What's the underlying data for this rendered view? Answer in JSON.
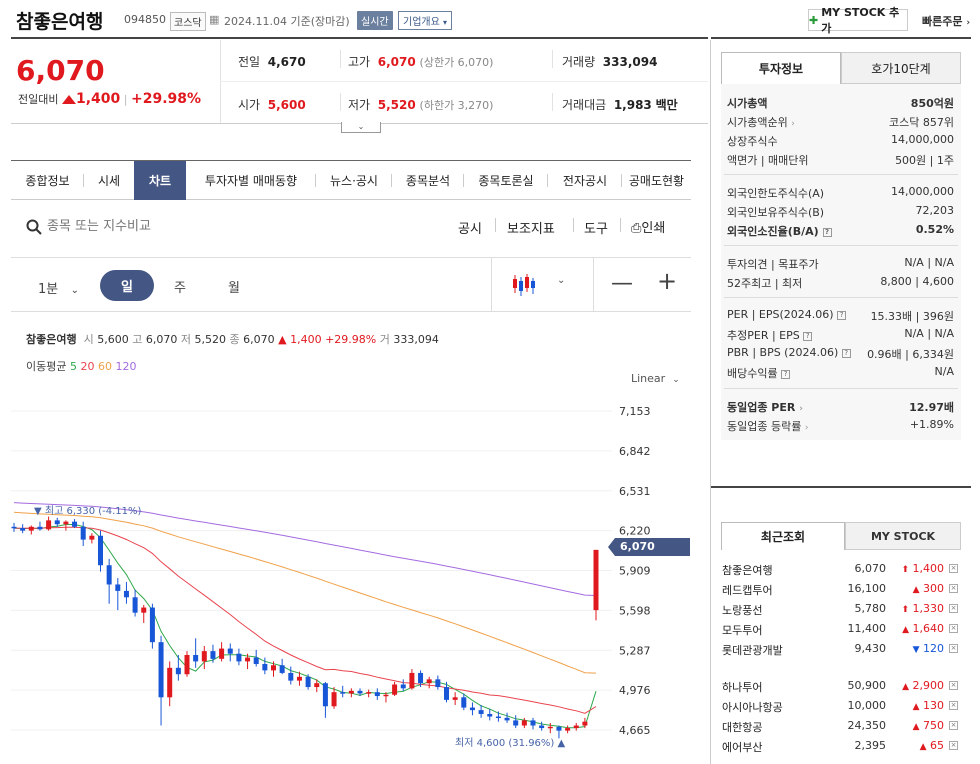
{
  "header": {
    "name": "참좋은여행",
    "code": "094850",
    "market": "코스닥",
    "date": "2024.11.04",
    "basis": "기준(장마감)",
    "realtime": "실시간",
    "company_info": "기업개요",
    "mystock_btn": "MY STOCK 추가",
    "quick_order": "빠른주문"
  },
  "quote": {
    "price": "6,070",
    "change_label": "전일대비",
    "change": "1,400",
    "change_pct": "+29.98%",
    "prev_label": "전일",
    "prev": "4,670",
    "high_label": "고가",
    "high": "6,070",
    "upper_limit": "(상한가 6,070)",
    "volume_label": "거래량",
    "volume": "333,094",
    "open_label": "시가",
    "open": "5,600",
    "low_label": "저가",
    "low": "5,520",
    "lower_limit": "(하한가 3,270)",
    "amount_label": "거래대금",
    "amount": "1,983",
    "amount_unit": "백만"
  },
  "tabs": [
    "종합정보",
    "시세",
    "차트",
    "투자자별 매매동향",
    "뉴스·공시",
    "종목분석",
    "종목토론실",
    "전자공시",
    "공매도현황"
  ],
  "search": {
    "placeholder": "종목 또는 지수비교",
    "tools": [
      "공시",
      "보조지표",
      "도구",
      "인쇄"
    ]
  },
  "periods": {
    "minute": "1분",
    "day": "일",
    "week": "주",
    "month": "월"
  },
  "chart_info": {
    "name": "참좋은여행",
    "open_label": "시",
    "open": "5,600",
    "high_label": "고",
    "high": "6,070",
    "low_label": "저",
    "low": "5,520",
    "close_label": "종",
    "close": "6,070",
    "change": "1,400",
    "pct": "+29.98%",
    "vol_label": "거",
    "vol": "333,094",
    "ma_label": "이동평균",
    "ma": [
      "5",
      "20",
      "60",
      "120"
    ],
    "scale": "Linear",
    "max_note": "최고 6,330 (-4.11%)",
    "min_note": "최저 4,600 (31.96%)",
    "current_tag": "6,070"
  },
  "colors": {
    "up": "#e0191f",
    "down": "#1756d6",
    "ma5": "#2ea84a",
    "ma20": "#e9444f",
    "ma60": "#f0a14a",
    "ma120": "#a46be0",
    "accent": "#445784"
  },
  "chart_data": {
    "type": "candlestick",
    "y_ticks": [
      "7,153",
      "6,842",
      "6,531",
      "6,220",
      "5,909",
      "5,598",
      "5,287",
      "4,976",
      "4,665"
    ],
    "ylim": [
      4600,
      7250
    ],
    "candles": [
      [
        6250,
        6280,
        6210,
        6240
      ],
      [
        6240,
        6270,
        6200,
        6220
      ],
      [
        6220,
        6260,
        6190,
        6250
      ],
      [
        6250,
        6290,
        6220,
        6230
      ],
      [
        6230,
        6330,
        6220,
        6300
      ],
      [
        6300,
        6320,
        6250,
        6270
      ],
      [
        6270,
        6300,
        6220,
        6290
      ],
      [
        6290,
        6310,
        6240,
        6250
      ],
      [
        6250,
        6290,
        6100,
        6150
      ],
      [
        6150,
        6200,
        6120,
        6180
      ],
      [
        6180,
        6220,
        5900,
        5950
      ],
      [
        5950,
        6000,
        5650,
        5800
      ],
      [
        5800,
        5850,
        5600,
        5750
      ],
      [
        5750,
        5820,
        5650,
        5700
      ],
      [
        5700,
        5760,
        5550,
        5580
      ],
      [
        5580,
        5640,
        5500,
        5620
      ],
      [
        5620,
        5650,
        5300,
        5350
      ],
      [
        5350,
        5400,
        4700,
        4920
      ],
      [
        4920,
        5200,
        4850,
        5150
      ],
      [
        5150,
        5250,
        5050,
        5100
      ],
      [
        5100,
        5280,
        5080,
        5250
      ],
      [
        5250,
        5380,
        5150,
        5200
      ],
      [
        5200,
        5320,
        5140,
        5280
      ],
      [
        5280,
        5330,
        5190,
        5220
      ],
      [
        5220,
        5350,
        5200,
        5300
      ],
      [
        5300,
        5340,
        5200,
        5260
      ],
      [
        5260,
        5300,
        5170,
        5200
      ],
      [
        5200,
        5260,
        5140,
        5230
      ],
      [
        5230,
        5290,
        5160,
        5180
      ],
      [
        5180,
        5230,
        5100,
        5130
      ],
      [
        5130,
        5200,
        5080,
        5170
      ],
      [
        5170,
        5220,
        5100,
        5110
      ],
      [
        5110,
        5160,
        5020,
        5050
      ],
      [
        5050,
        5120,
        5010,
        5080
      ],
      [
        5080,
        5100,
        4980,
        5000
      ],
      [
        5000,
        5060,
        4960,
        5030
      ],
      [
        5030,
        5040,
        4760,
        4850
      ],
      [
        4850,
        5000,
        4830,
        4960
      ],
      [
        4960,
        5010,
        4920,
        4950
      ],
      [
        4950,
        4990,
        4920,
        4970
      ],
      [
        4970,
        4990,
        4930,
        4950
      ],
      [
        4950,
        4980,
        4920,
        4960
      ],
      [
        4960,
        4990,
        4900,
        4930
      ],
      [
        4930,
        4960,
        4880,
        4940
      ],
      [
        4940,
        5040,
        4930,
        5020
      ],
      [
        5020,
        5060,
        4970,
        4990
      ],
      [
        4990,
        5140,
        4980,
        5110
      ],
      [
        5110,
        5130,
        5000,
        5030
      ],
      [
        5030,
        5080,
        4990,
        5060
      ],
      [
        5060,
        5090,
        4980,
        5000
      ],
      [
        5000,
        5040,
        4880,
        4900
      ],
      [
        4900,
        4960,
        4860,
        4920
      ],
      [
        4920,
        4950,
        4820,
        4840
      ],
      [
        4840,
        4880,
        4780,
        4820
      ],
      [
        4820,
        4860,
        4760,
        4790
      ],
      [
        4790,
        4830,
        4740,
        4770
      ],
      [
        4770,
        4810,
        4730,
        4760
      ],
      [
        4760,
        4800,
        4720,
        4740
      ],
      [
        4740,
        4780,
        4680,
        4700
      ],
      [
        4700,
        4760,
        4680,
        4740
      ],
      [
        4740,
        4760,
        4670,
        4700
      ],
      [
        4700,
        4730,
        4660,
        4680
      ],
      [
        4680,
        4720,
        4640,
        4690
      ],
      [
        4690,
        4700,
        4600,
        4660
      ],
      [
        4660,
        4700,
        4640,
        4680
      ],
      [
        4680,
        4720,
        4660,
        4700
      ],
      [
        4700,
        4760,
        4680,
        4730
      ],
      [
        5600,
        6070,
        5520,
        6070
      ]
    ]
  },
  "right": {
    "tab_invest": "투자정보",
    "tab_hoga": "호가10단계",
    "rows1": [
      {
        "l": "시가총액",
        "r": "850억원"
      },
      {
        "l": "시가총액순위",
        "r": "코스닥 857위"
      },
      {
        "l": "상장주식수",
        "r": "14,000,000"
      },
      {
        "l": "액면가 | 매매단위",
        "r": "500원 | 1주"
      }
    ],
    "rows2": [
      {
        "l": "외국인한도주식수(A)",
        "r": "14,000,000"
      },
      {
        "l": "외국인보유주식수(B)",
        "r": "72,203"
      },
      {
        "l": "외국인소진율(B/A)",
        "r": "0.52%"
      }
    ],
    "rows3": [
      {
        "l": "투자의견 | 목표주가",
        "r": "N/A | N/A"
      },
      {
        "l": "52주최고 | 최저",
        "r": "8,800 | 4,600"
      }
    ],
    "rows4": [
      {
        "l": "PER | EPS(2024.06)",
        "r": "15.33배 | 396원"
      },
      {
        "l": "추정PER | EPS",
        "r": "N/A | N/A"
      },
      {
        "l": "PBR | BPS (2024.06)",
        "r": "0.96배 | 6,334원"
      },
      {
        "l": "배당수익률",
        "r": "N/A"
      }
    ],
    "rows5": [
      {
        "l": "동일업종 PER",
        "r": "12.97배"
      },
      {
        "l": "동일업종 등락률",
        "r": "+1.89%"
      }
    ],
    "tab_recent": "최근조회",
    "tab_mystock": "MY STOCK",
    "recent1": [
      {
        "n": "참좋은여행",
        "p": "6,070",
        "c": "1,400",
        "d": "up-strong"
      },
      {
        "n": "레드캡투어",
        "p": "16,100",
        "c": "300",
        "d": "up"
      },
      {
        "n": "노랑풍선",
        "p": "5,780",
        "c": "1,330",
        "d": "up-strong"
      },
      {
        "n": "모두투어",
        "p": "11,400",
        "c": "1,640",
        "d": "up"
      },
      {
        "n": "롯데관광개발",
        "p": "9,430",
        "c": "120",
        "d": "down"
      }
    ],
    "recent2": [
      {
        "n": "하나투어",
        "p": "50,900",
        "c": "2,900",
        "d": "up"
      },
      {
        "n": "아시아나항공",
        "p": "10,000",
        "c": "130",
        "d": "up"
      },
      {
        "n": "대한항공",
        "p": "24,350",
        "c": "750",
        "d": "up"
      },
      {
        "n": "에어부산",
        "p": "2,395",
        "c": "65",
        "d": "up"
      }
    ]
  }
}
